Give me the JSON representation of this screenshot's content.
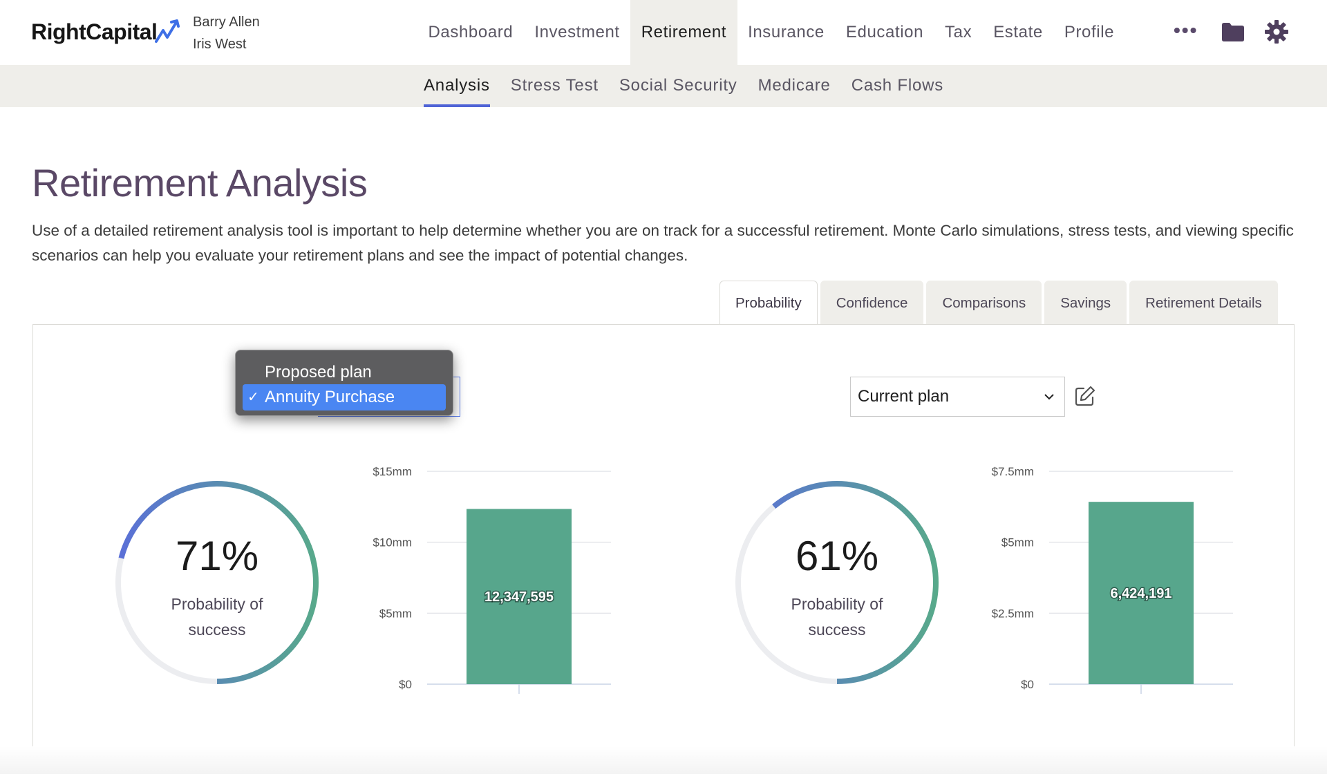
{
  "header": {
    "logo_text": "RightCapital",
    "client_primary": "Barry Allen",
    "client_secondary": "Iris West",
    "nav": [
      "Dashboard",
      "Investment",
      "Retirement",
      "Insurance",
      "Education",
      "Tax",
      "Estate",
      "Profile"
    ],
    "active_nav": "Retirement",
    "more_label": "•••"
  },
  "subnav": {
    "items": [
      "Analysis",
      "Stress Test",
      "Social Security",
      "Medicare",
      "Cash Flows"
    ],
    "active": "Analysis"
  },
  "page": {
    "title": "Retirement Analysis",
    "description": "Use of a detailed retirement analysis tool is important to help determine whether you are on track for a successful retirement. Monte Carlo simulations, stress tests, and viewing specific scenarios can help you evaluate your retirement plans and see the impact of potential changes."
  },
  "tabs": {
    "items": [
      "Probability",
      "Confidence",
      "Comparisons",
      "Savings",
      "Retirement Details"
    ],
    "active": "Probability"
  },
  "left_plan": {
    "dropdown_options": [
      "Proposed plan",
      "Annuity Purchase"
    ],
    "selected": "Annuity Purchase",
    "checkmark": "✓",
    "probability_pct": "71%",
    "probability_value": 71,
    "probability_label_line1": "Probability of",
    "probability_label_line2": "success"
  },
  "right_plan": {
    "selected": "Current plan",
    "probability_pct": "61%",
    "probability_value": 61,
    "probability_label_line1": "Probability of",
    "probability_label_line2": "success"
  },
  "colors": {
    "accent": "#4f63d6",
    "bar": "#57a68c",
    "ring_start": "#5a6fd8",
    "ring_end": "#58a98b",
    "ring_track": "#ecedf0",
    "title": "#5a4866",
    "popup_highlight": "#4a86f2"
  },
  "chart_data": [
    {
      "type": "bar",
      "categories": [
        ""
      ],
      "values": [
        12347595
      ],
      "data_labels": [
        "12,347,595"
      ],
      "ylim": [
        0,
        15000000
      ],
      "yticks": [
        0,
        5000000,
        10000000,
        15000000
      ],
      "ytick_labels": [
        "$0",
        "$5mm",
        "$10mm",
        "$15mm"
      ],
      "grid": true
    },
    {
      "type": "bar",
      "categories": [
        ""
      ],
      "values": [
        6424191
      ],
      "data_labels": [
        "6,424,191"
      ],
      "ylim": [
        0,
        7500000
      ],
      "yticks": [
        0,
        2500000,
        5000000,
        7500000
      ],
      "ytick_labels": [
        "$0",
        "$2.5mm",
        "$5mm",
        "$7.5mm"
      ],
      "grid": true
    }
  ]
}
